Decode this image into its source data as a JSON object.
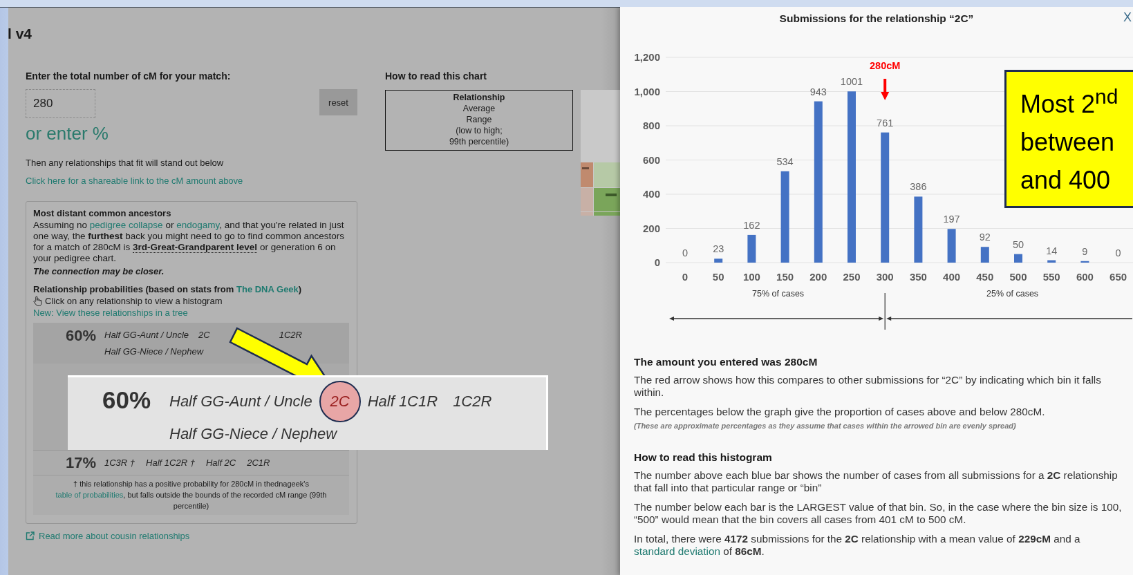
{
  "page": {
    "title": "l v4"
  },
  "calculator": {
    "label": "Enter the total number of cM for your match:",
    "value": "280",
    "reset": "reset",
    "percent_link": "or enter %",
    "hint": "Then any relationships that fit will stand out below",
    "share_link": "Click here for a shareable link to the cM amount above"
  },
  "ancestors": {
    "heading": "Most distant common ancestors",
    "paragraph": [
      {
        "kind": "plain",
        "text": "Assuming no "
      },
      {
        "kind": "link",
        "text": "pedigree collapse"
      },
      {
        "kind": "plain",
        "text": " or "
      },
      {
        "kind": "link",
        "text": "endogamy"
      },
      {
        "kind": "plain",
        "text": ", and that you're related in just one way, the "
      },
      {
        "kind": "bold",
        "text": "furthest"
      },
      {
        "kind": "plain",
        "text": " back you might need to go to find common ancestors for a match of 280cM is "
      },
      {
        "kind": "term",
        "text": "3rd-Great-Grandparent level"
      },
      {
        "kind": "plain",
        "text": " or generation 6 on your pedigree chart."
      }
    ],
    "note": "The connection may be closer."
  },
  "probabilities": {
    "heading": [
      {
        "kind": "plain",
        "text": "Relationship probabilities (based on stats from "
      },
      {
        "kind": "link",
        "text": "The DNA Geek"
      },
      {
        "kind": "plain",
        "text": ")"
      }
    ],
    "instruction": "Click on any relationship to view a histogram",
    "tree_link": "New: View these relationships in a tree",
    "rows": [
      {
        "percent": "60%",
        "relationships": [
          "Half GG-Aunt / Uncle",
          "2C",
          "1C2R",
          "Half GG-Niece / Nephew"
        ]
      },
      {
        "percent": "17%",
        "relationships": [
          "1C3R †",
          "Half 1C2R †",
          "Half 2C",
          "2C1R"
        ]
      }
    ],
    "footnote": [
      {
        "kind": "plain",
        "text": "† this relationship has a positive probability for 280cM in thednageek's "
      },
      {
        "kind": "link",
        "text": "table of probabilities"
      },
      {
        "kind": "plain",
        "text": ", but falls outside the bounds of the recorded cM range (99th percentile)"
      }
    ]
  },
  "read_more": "Read more about cousin relationships",
  "how_to_read": {
    "heading": "How to read this chart",
    "legend": [
      "Relationship",
      "Average",
      "Range",
      "(low to high;",
      "99th percentile)"
    ]
  },
  "callout": {
    "percent": "60%",
    "relationships": [
      {
        "label": "Half GG-Aunt / Uncle",
        "circled": false
      },
      {
        "label": "2C",
        "circled": true
      },
      {
        "label": "Half 1C1R",
        "circled": false
      },
      {
        "label": "1C2R",
        "circled": false
      },
      {
        "label": "Half GG-Niece / Nephew",
        "circled": false
      }
    ]
  },
  "histogram": {
    "title": "Submissions for the relationship “2C”",
    "close": "X",
    "chart_data": {
      "type": "bar",
      "categories": [
        "0",
        "50",
        "100",
        "150",
        "200",
        "250",
        "300",
        "350",
        "400",
        "450",
        "500",
        "550",
        "600",
        "650"
      ],
      "series": [
        {
          "color": "#4472c4",
          "values": [
            0,
            23,
            162,
            534,
            943,
            1001,
            761,
            386,
            197,
            92,
            50,
            14,
            9,
            0
          ]
        }
      ],
      "ylim": [
        0,
        1200
      ],
      "grid": true,
      "yticks": [
        0,
        200,
        400,
        600,
        800,
        {
          "value": 1000,
          "label": "1,000"
        },
        {
          "value": 1200,
          "label": "1,200"
        }
      ],
      "data_labels": true,
      "annotations": [
        "280cM"
      ]
    },
    "bins": [
      {
        "marked": false
      },
      {
        "marked": false
      },
      {
        "marked": false
      },
      {
        "marked": false
      },
      {
        "marked": false
      },
      {
        "marked": false
      },
      {
        "marked": true
      },
      {
        "marked": false
      },
      {
        "marked": false
      },
      {
        "marked": false
      },
      {
        "marked": false
      },
      {
        "marked": false
      },
      {
        "marked": false
      },
      {
        "marked": false
      }
    ],
    "split": {
      "left_label": "75% of cases",
      "right_label": "25% of cases"
    },
    "note_box": {
      "lines": [
        "Most 2$^{nd}$",
        "between",
        "and 400"
      ]
    },
    "sections": [
      {
        "heading": "The amount you entered was 280cM",
        "paragraphs": [
          {
            "kind": "normal",
            "segments": [
              {
                "kind": "plain",
                "text": "The red arrow shows how this compares to other submissions for “2C” by indicating which bin it falls within."
              }
            ]
          },
          {
            "kind": "normal",
            "segments": [
              {
                "kind": "plain",
                "text": "The percentages below the graph give the proportion of cases above and below 280cM."
              }
            ]
          },
          {
            "kind": "small",
            "segments": [
              {
                "kind": "plain",
                "text": "(These are approximate percentages as they assume that cases within the arrowed bin are evenly spread)"
              }
            ]
          }
        ]
      },
      {
        "heading": "How to read this histogram",
        "paragraphs": [
          {
            "kind": "normal",
            "segments": [
              {
                "kind": "plain",
                "text": "The number above each blue bar shows the number of cases from all submissions for a "
              },
              {
                "kind": "bold",
                "text": "2C"
              },
              {
                "kind": "plain",
                "text": " relationship that fall into that particular range or “bin”"
              }
            ]
          },
          {
            "kind": "normal",
            "segments": [
              {
                "kind": "plain",
                "text": "The number below each bar is the LARGEST value of that bin. So, in the case where the bin size is 100, “500” would mean that the bin covers all cases from 401 cM to 500 cM."
              }
            ]
          },
          {
            "kind": "normal",
            "segments": [
              {
                "kind": "plain",
                "text": "In total, there were "
              },
              {
                "kind": "bold",
                "text": "4172"
              },
              {
                "kind": "plain",
                "text": " submissions for the "
              },
              {
                "kind": "bold",
                "text": "2C"
              },
              {
                "kind": "plain",
                "text": " relationship with a mean value of "
              },
              {
                "kind": "bold",
                "text": "229cM"
              },
              {
                "kind": "plain",
                "text": " and a "
              },
              {
                "kind": "link",
                "text": "standard deviation"
              },
              {
                "kind": "plain",
                "text": " of "
              },
              {
                "kind": "bold",
                "text": "86cM"
              },
              {
                "kind": "plain",
                "text": "."
              }
            ]
          }
        ]
      }
    ]
  }
}
